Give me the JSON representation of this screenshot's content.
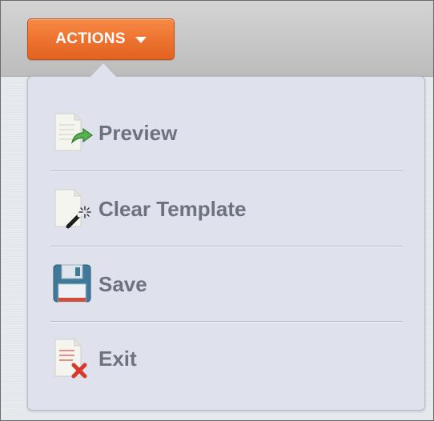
{
  "toolbar": {
    "actions_label": "ACTIONS"
  },
  "menu": {
    "items": [
      {
        "label": "Preview",
        "icon": "preview-icon"
      },
      {
        "label": "Clear Template",
        "icon": "clear-template-icon"
      },
      {
        "label": "Save",
        "icon": "save-icon"
      },
      {
        "label": "Exit",
        "icon": "exit-icon"
      }
    ]
  },
  "colors": {
    "accent": "#ee7330",
    "menu_background": "#dfe1ec",
    "menu_text": "#6e7280"
  }
}
